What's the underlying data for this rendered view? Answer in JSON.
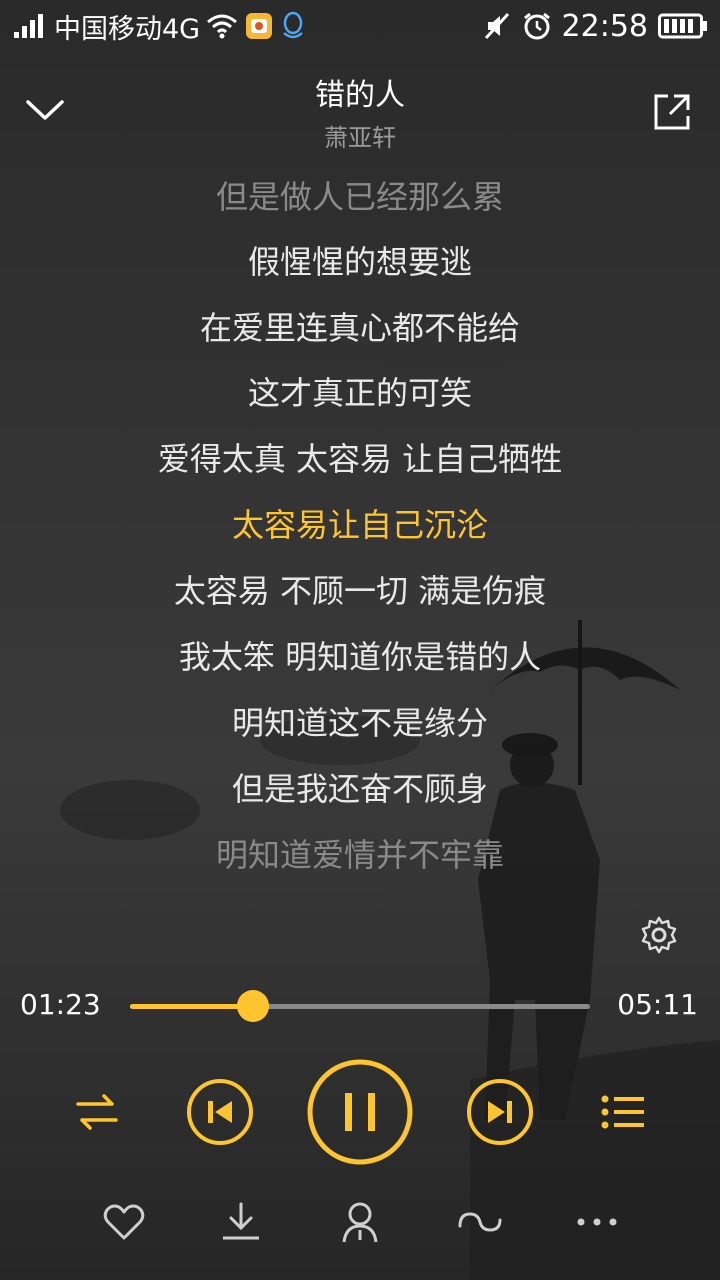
{
  "status_bar": {
    "carrier": "中国移动4G",
    "time": "22:58"
  },
  "header": {
    "song_title": "错的人",
    "artist": "萧亚轩"
  },
  "lyrics": [
    {
      "text": "但是做人已经那么累",
      "state": "dim"
    },
    {
      "text": "假惺惺的想要逃",
      "state": "normal"
    },
    {
      "text": "在爱里连真心都不能给",
      "state": "normal"
    },
    {
      "text": "这才真正的可笑",
      "state": "normal"
    },
    {
      "text": "爱得太真 太容易 让自己牺牲",
      "state": "normal"
    },
    {
      "text": "太容易让自己沉沦",
      "state": "current"
    },
    {
      "text": "太容易 不顾一切 满是伤痕",
      "state": "normal"
    },
    {
      "text": "我太笨 明知道你是错的人",
      "state": "normal"
    },
    {
      "text": "明知道这不是缘分",
      "state": "normal"
    },
    {
      "text": "但是我还奋不顾身",
      "state": "normal"
    },
    {
      "text": "明知道爱情并不牢靠",
      "state": "dim"
    }
  ],
  "player": {
    "elapsed": "01:23",
    "total": "05:11",
    "progress_fraction": 0.267,
    "state": "playing"
  },
  "colors": {
    "accent": "#ffc52f",
    "lyric": "#e9e9e9",
    "lyric_dim": "#8a8a8a"
  },
  "icons": {
    "back": "chevron-down-icon",
    "share": "share-icon",
    "settings": "gear-icon",
    "shuffle": "shuffle-icon",
    "previous": "previous-icon",
    "pause": "pause-icon",
    "next": "next-icon",
    "playlist": "playlist-icon",
    "favorite": "heart-icon",
    "download": "download-icon",
    "singer": "singer-icon",
    "loop": "loop-icon",
    "more": "more-icon"
  }
}
